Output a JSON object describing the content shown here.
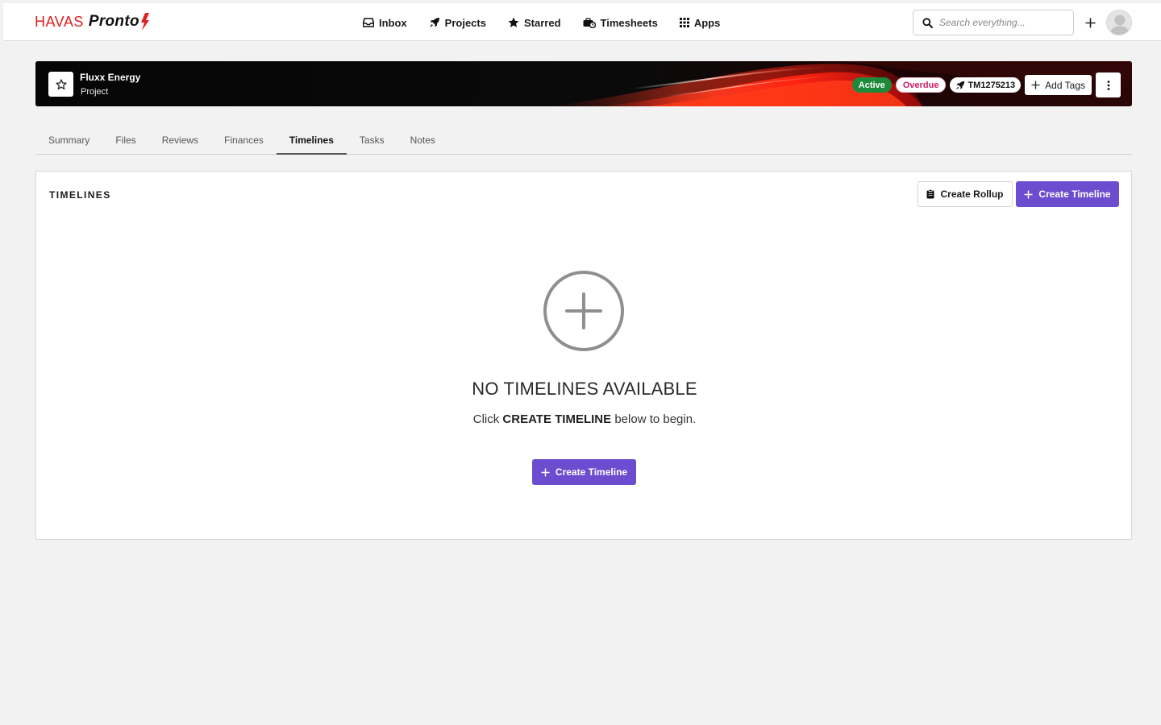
{
  "brand": {
    "name_part1": "HAVAS",
    "name_part2": "Pronto",
    "accent_color": "#e02020"
  },
  "topnav": {
    "items": [
      {
        "label": "Inbox",
        "icon": "inbox-icon"
      },
      {
        "label": "Projects",
        "icon": "rocket-icon"
      },
      {
        "label": "Starred",
        "icon": "star-icon"
      },
      {
        "label": "Timesheets",
        "icon": "timesheets-icon"
      },
      {
        "label": "Apps",
        "icon": "grid-icon"
      }
    ],
    "search_placeholder": "Search everything..."
  },
  "project": {
    "name": "Fluxx Energy",
    "type": "Project",
    "status_badge": "Active",
    "overdue_badge": "Overdue",
    "job_number": "TM1275213",
    "add_tags_label": "Add Tags",
    "colors": {
      "active": "#1c8a3a",
      "overdue": "#d01862"
    }
  },
  "tabs": [
    {
      "label": "Summary",
      "active": false
    },
    {
      "label": "Files",
      "active": false
    },
    {
      "label": "Reviews",
      "active": false
    },
    {
      "label": "Finances",
      "active": false
    },
    {
      "label": "Timelines",
      "active": true
    },
    {
      "label": "Tasks",
      "active": false
    },
    {
      "label": "Notes",
      "active": false
    }
  ],
  "timelines": {
    "title": "TIMELINES",
    "create_rollup_label": "Create Rollup",
    "create_timeline_label": "Create Timeline",
    "empty_title": "NO TIMELINES AVAILABLE",
    "empty_sub_prefix": "Click",
    "empty_sub_strong": "CREATE TIMELINE",
    "empty_sub_suffix": "below to begin.",
    "primary_color": "#6c4ccf"
  }
}
